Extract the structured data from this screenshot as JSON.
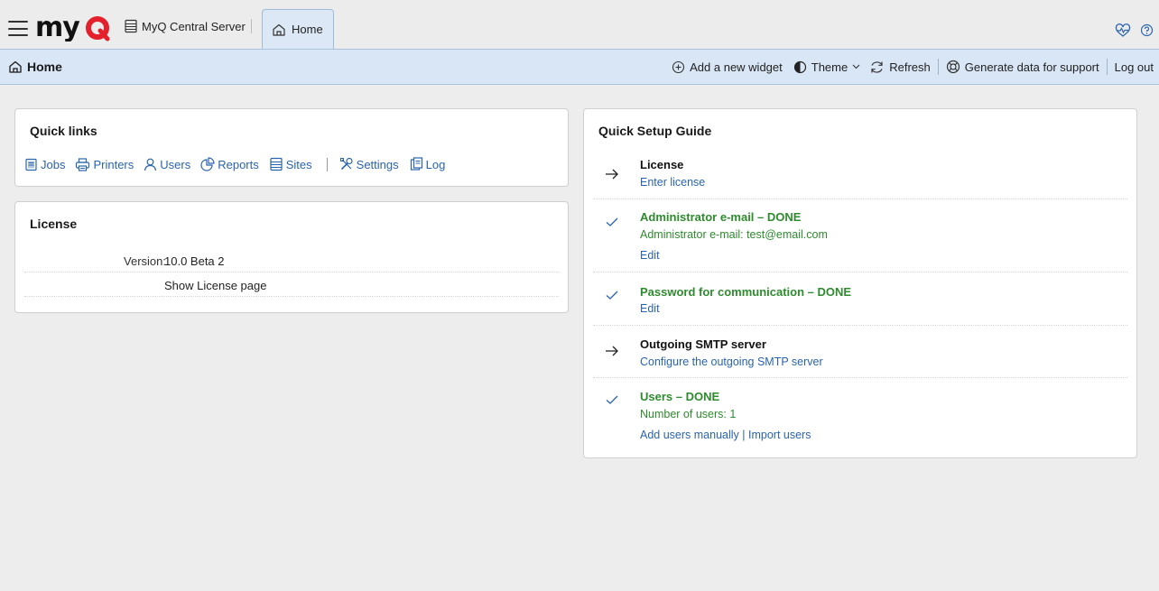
{
  "app": {
    "logo": "myQ",
    "server_name": "MyQ Central Server",
    "tab_label": "Home"
  },
  "header": {
    "title": "Home",
    "actions": {
      "add_widget": "Add a new widget",
      "theme": "Theme",
      "refresh": "Refresh",
      "support": "Generate data for support",
      "logout": "Log out"
    }
  },
  "quick_links": {
    "title": "Quick links",
    "items": [
      {
        "label": "Jobs",
        "icon": "jobs-icon"
      },
      {
        "label": "Printers",
        "icon": "printer-icon"
      },
      {
        "label": "Users",
        "icon": "user-icon"
      },
      {
        "label": "Reports",
        "icon": "reports-icon"
      },
      {
        "label": "Sites",
        "icon": "sites-icon"
      },
      {
        "label": "Settings",
        "icon": "settings-icon"
      },
      {
        "label": "Log",
        "icon": "log-icon"
      }
    ]
  },
  "license": {
    "title": "License",
    "version_label": "Version:",
    "version_value": "10.0 Beta 2",
    "show_link": "Show License page"
  },
  "setup_guide": {
    "title": "Quick Setup Guide",
    "items": [
      {
        "status": "todo",
        "title": "License",
        "link": "Enter license"
      },
      {
        "status": "done",
        "title": "Administrator e-mail – DONE",
        "detail": "Administrator e-mail: test@email.com",
        "link": "Edit"
      },
      {
        "status": "done",
        "title": "Password for communication – DONE",
        "link": "Edit"
      },
      {
        "status": "todo",
        "title": "Outgoing SMTP server",
        "link": "Configure the outgoing SMTP server"
      },
      {
        "status": "done",
        "title": "Users – DONE",
        "detail": "Number of users: 1",
        "link_a": "Add users manually",
        "link_sep": "|",
        "link_b": "Import users"
      }
    ]
  },
  "colors": {
    "accent": "#2a64ad",
    "done": "#2e8b2e",
    "header_bg": "#d9e6f5",
    "logo_red": "#e4202c"
  }
}
